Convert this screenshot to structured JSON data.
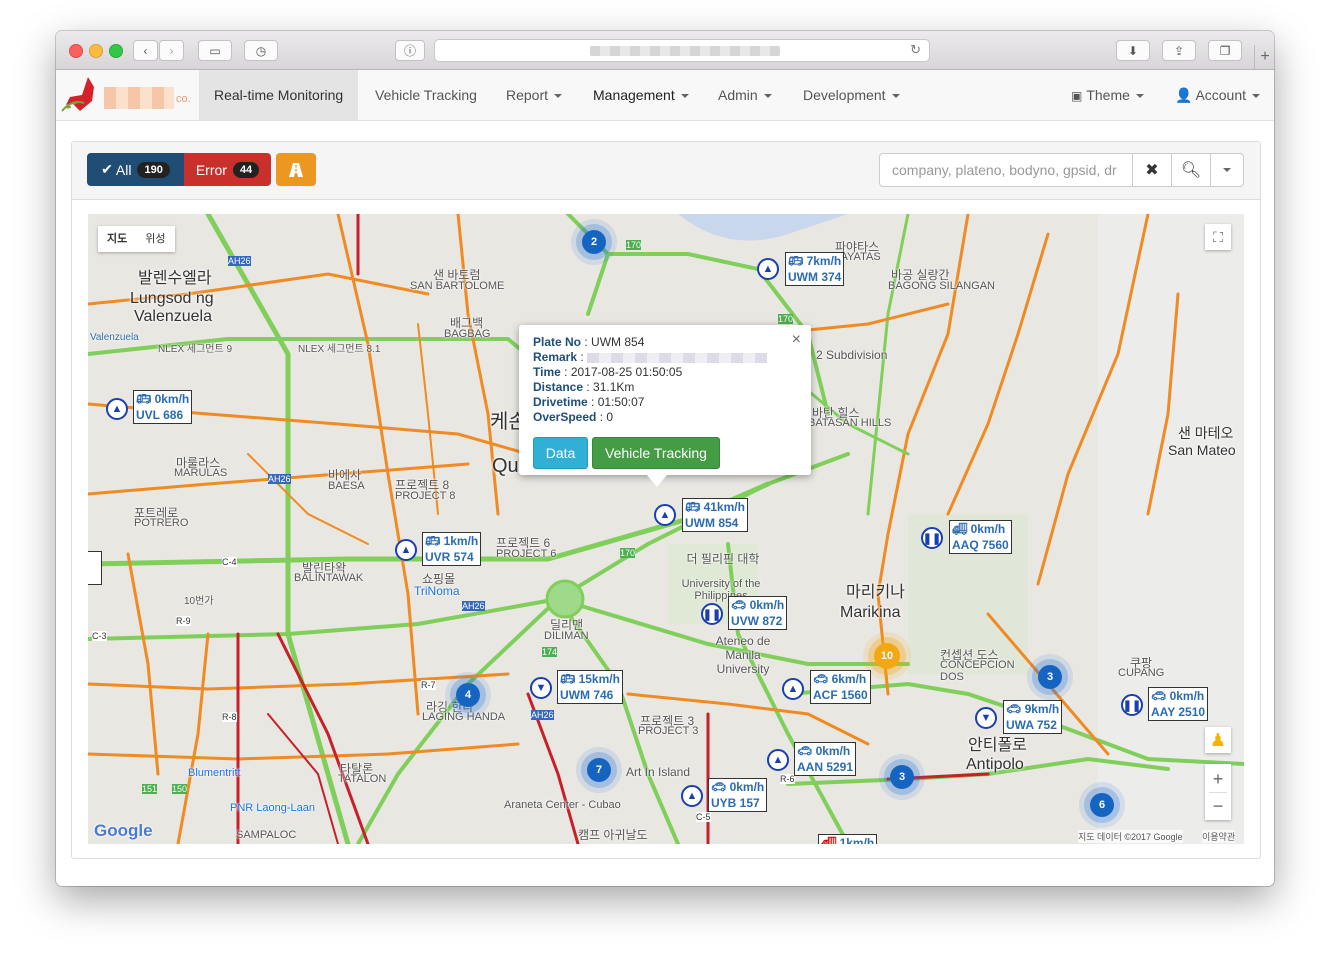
{
  "browser": {
    "url_placeholder": ""
  },
  "nav": {
    "logo_suffix": "co.",
    "items": [
      {
        "label": "Real-time Monitoring"
      },
      {
        "label": "Vehicle Tracking"
      },
      {
        "label": "Report"
      },
      {
        "label": "Management"
      },
      {
        "label": "Admin"
      },
      {
        "label": "Development"
      }
    ],
    "theme": "Theme",
    "account": "Account"
  },
  "toolbar": {
    "all_label": "All",
    "all_count": "190",
    "error_label": "Error",
    "error_count": "44",
    "search_placeholder": "company, plateno, bodyno, gpsid, dr"
  },
  "map": {
    "type_map": "지도",
    "type_satellite": "위성",
    "attribution": "지도 데이터 ©2017 Google",
    "terms": "이용약관",
    "google": "Google",
    "labels": [
      "발렌수엘라",
      "Lungsod ng",
      "Valenzuela",
      "케손",
      "Quezon",
      "마리키나",
      "Marikina",
      "안티폴로",
      "Antipolo",
      "샌 마테오",
      "San Mateo",
      "샌 바토럼",
      "SAN BARTOLOME",
      "배그백",
      "BAGBAG",
      "파야타스",
      "PAYATAS",
      "바공 실랑간",
      "BAGONG SILANGAN",
      "2 Subdivision",
      "바탄 힐스",
      "BATASAN HILLS",
      "바에사",
      "BAESA",
      "마룰라스",
      "MARULAS",
      "포트레로",
      "POTRERO",
      "발린타왁",
      "BALINTAWAK",
      "쇼핑몰",
      "TriNoma",
      "더 필리핀 대학",
      "University of the Philippines",
      "Ateneo de Manila University",
      "딜리맨",
      "DILIMAN",
      "컨셉션 도스",
      "CONCEPCION DOS",
      "쿠팡",
      "CUPANG",
      "라깅 한다",
      "LAGING HANDA",
      "Art In Island",
      "Araneta Center - Cubao",
      "타탈론",
      "TATALON",
      "Blumentritt",
      "PNR Laong-Laan",
      "SAMPALOC",
      "캠프 아귀날도",
      "프로젝트 3",
      "PROJECT 3",
      "프로젝트 8",
      "PROJECT 8",
      "프로젝트 6",
      "PROJECT 6",
      "Valenzuela",
      "NLEX 세그먼트 9",
      "NLEX 세그먼트 8.1",
      "C-4",
      "C-3",
      "C-5",
      "R-7",
      "R-8",
      "R-9",
      "R-6",
      "AH26",
      "170",
      "174",
      "151",
      "150",
      "10번가"
    ]
  },
  "popup": {
    "plate_label": "Plate No",
    "plate_value": "UWM 854",
    "remark_label": "Remark",
    "time_label": "Time",
    "time_value": "2017-08-25 01:50:05",
    "distance_label": "Distance",
    "distance_value": "31.1Km",
    "drivetime_label": "Drivetime",
    "drivetime_value": "01:50:07",
    "overspeed_label": "OverSpeed",
    "overspeed_value": "0",
    "data_button": "Data",
    "tracking_button": "Vehicle Tracking"
  },
  "vehicles": [
    {
      "speed": "7km/h",
      "plate": "UWM 374"
    },
    {
      "speed": "0km/h",
      "plate": "UVL 686"
    },
    {
      "speed": "41km/h",
      "plate": "UWM 854"
    },
    {
      "speed": "1km/h",
      "plate": "UVR 574"
    },
    {
      "speed": "0km/h",
      "plate": "AAQ 7560"
    },
    {
      "speed": "0km/h",
      "plate": "UVW 872"
    },
    {
      "speed": "15km/h",
      "plate": "UWM 746"
    },
    {
      "speed": "6km/h",
      "plate": "ACF 1560"
    },
    {
      "speed": "0km/h",
      "plate": "AAN 5291"
    },
    {
      "speed": "0km/h",
      "plate": "UYB 157"
    },
    {
      "speed": "9km/h",
      "plate": "UWA 752"
    },
    {
      "speed": "0km/h",
      "plate": "AAY 2510"
    },
    {
      "speed": "1km/h",
      "plate": ""
    }
  ],
  "clusters": [
    "2",
    "10",
    "4",
    "7",
    "3",
    "3",
    "6"
  ],
  "colors": {
    "nav_bg": "#f8f8f8",
    "all_btn": "#204d74",
    "error_btn": "#c9302c",
    "warn_btn": "#ec971f",
    "data_btn": "#31b0d5",
    "tracking_btn": "#449d44"
  }
}
